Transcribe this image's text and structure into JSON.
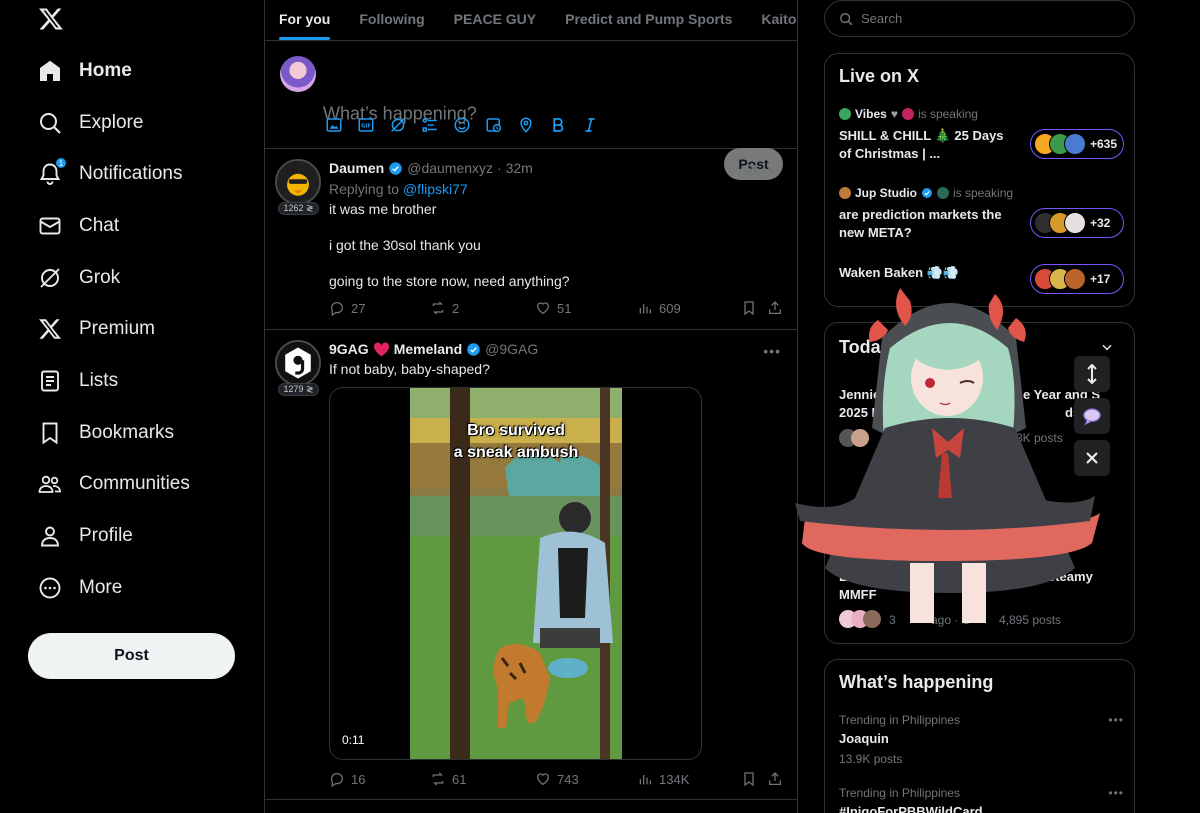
{
  "nav": {
    "items": [
      {
        "label": "Home",
        "icon": "home-icon",
        "active": true
      },
      {
        "label": "Explore",
        "icon": "search-icon"
      },
      {
        "label": "Notifications",
        "icon": "bell-icon",
        "badge": "1"
      },
      {
        "label": "Chat",
        "icon": "mail-icon"
      },
      {
        "label": "Grok",
        "icon": "grok-icon"
      },
      {
        "label": "Premium",
        "icon": "x-icon"
      },
      {
        "label": "Lists",
        "icon": "list-icon"
      },
      {
        "label": "Bookmarks",
        "icon": "bookmark-icon"
      },
      {
        "label": "Communities",
        "icon": "people-icon"
      },
      {
        "label": "Profile",
        "icon": "person-icon"
      },
      {
        "label": "More",
        "icon": "more-circle-icon"
      }
    ],
    "post_label": "Post"
  },
  "tabs": [
    "For you",
    "Following",
    "PEACE GUY",
    "Predict and Pump Sports",
    "Kaito Yapp"
  ],
  "composer": {
    "placeholder": "What’s happening?",
    "post_label": "Post"
  },
  "tweets": [
    {
      "name": "Daumen",
      "handle": "@daumenxyz",
      "time": "· 32m",
      "badge": "1262 ≷",
      "reply_prefix": "Replying to",
      "reply_to": "@flipski77",
      "lines": [
        "it was me brother",
        "i got the 30sol thank you",
        "going to the store now, need anything?"
      ],
      "stats": {
        "replies": "27",
        "reposts": "2",
        "likes": "51",
        "views": "609"
      }
    },
    {
      "name": "9GAG",
      "name2": "Memeland",
      "handle": "@9GAG",
      "badge": "1279 ≷",
      "text": "If not baby, baby-shaped?",
      "caption1": "Bro survived",
      "caption2": "a sneak ambush",
      "duration": "0:11",
      "stats": {
        "replies": "16",
        "reposts": "61",
        "likes": "743",
        "views": "134K"
      }
    }
  ],
  "search": {
    "placeholder": "Search"
  },
  "live": {
    "title": "Live on X",
    "spaces": [
      {
        "host": "Vibes",
        "host_suffix": "is speaking",
        "topic": "SHILL & CHILL 🎄 25 Days of Christmas | ...",
        "count": "+635"
      },
      {
        "host": "Jup Studio",
        "host_suffix": "is speaking",
        "topic": "are prediction markets the new META?",
        "count": "+32"
      },
      {
        "host": "",
        "host_suffix": "",
        "topic": "Waken Baken 💨💨",
        "count": "+17"
      }
    ]
  },
  "today": {
    "title": "Toda",
    "item1_title": "Jennie W",
    "item1_right": "e Year and S",
    "item1_line2a": "2025 Me",
    "item1_line2b": "ds",
    "item1_posts": "3K posts",
    "item2_title": "Lo",
    "item2_right": "n Steamy",
    "item2_line2": "MMFF",
    "item2_meta_a": "3",
    "item2_meta_b": "ago · C",
    "item2_posts": "4,895 posts"
  },
  "happening": {
    "title": "What’s happening",
    "trends": [
      {
        "meta": "Trending in Philippines",
        "name": "Joaquin",
        "posts": "13.9K posts"
      },
      {
        "meta": "Trending in Philippines",
        "name": "#InigoForPBBWildCard",
        "posts": ""
      }
    ]
  },
  "colors": {
    "accent": "#1d9bf0",
    "bg": "#000000",
    "border": "#2f3336",
    "muted": "#71767b",
    "live_ring": "#7856ff"
  }
}
